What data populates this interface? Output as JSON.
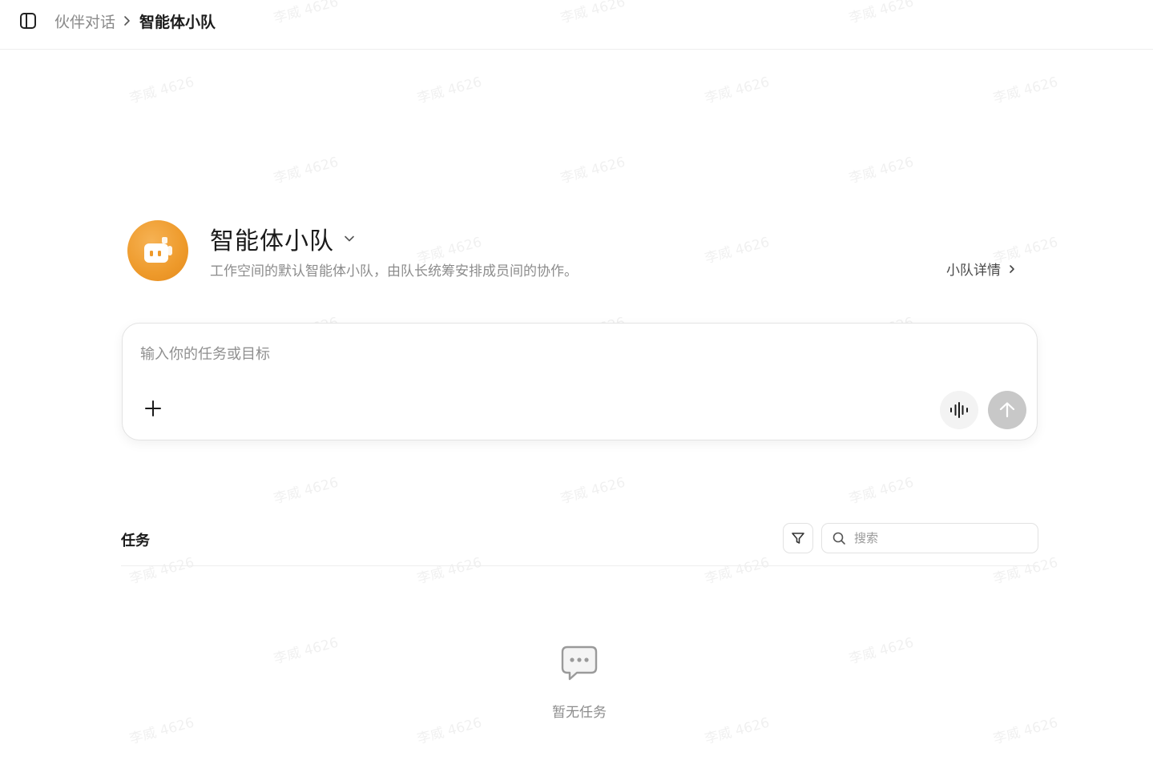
{
  "topbar": {
    "sidebar_toggle_icon": "sidebar-toggle-icon",
    "breadcrumb_parent": "伙伴对话",
    "breadcrumb_current": "智能体小队"
  },
  "team": {
    "avatar_icon": "robot-icon",
    "avatar_color": "#EE9A2B",
    "name": "智能体小队",
    "description": "工作空间的默认智能体小队，由队长统筹安排成员间的协作。",
    "detail_link": "小队详情"
  },
  "composer": {
    "placeholder": "输入你的任务或目标",
    "attach_icon": "plus-icon",
    "voice_icon": "voice-wave-icon",
    "send_icon": "arrow-up-icon"
  },
  "tasks": {
    "title": "任务",
    "filter_icon": "filter-icon",
    "search_placeholder": "搜索",
    "empty_text": "暂无任务",
    "empty_icon": "chat-bubble-icon"
  },
  "watermark": {
    "text": "李威 4626"
  }
}
